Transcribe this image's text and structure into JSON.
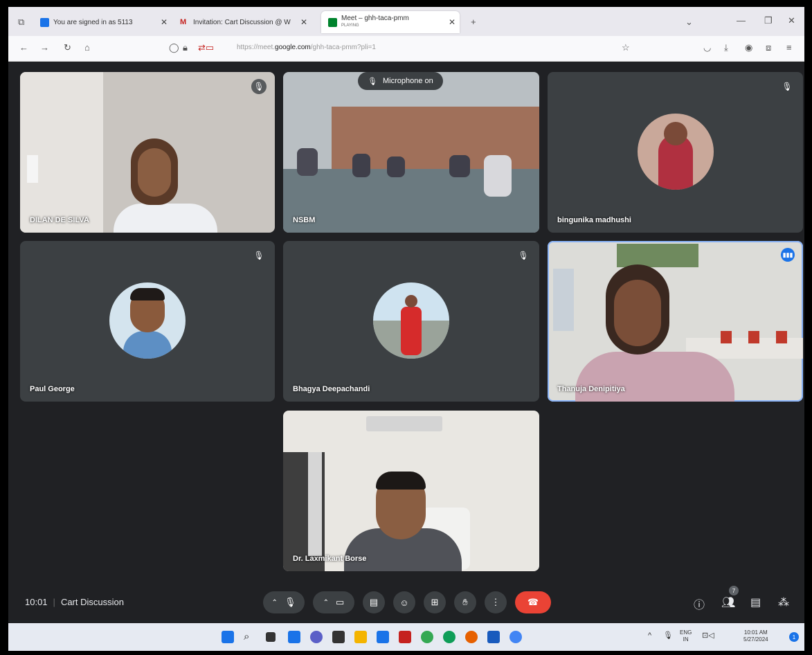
{
  "browser": {
    "tabs": [
      {
        "label": "You are signed in as 5113",
        "favicon_color": "#1a73e8"
      },
      {
        "label": "Invitation: Cart Discussion @ W",
        "favicon_color": "#c5221f"
      },
      {
        "label": "Meet – ghh-taca-pmm",
        "sublabel": "PLAYING",
        "favicon_color": "#00832d"
      }
    ],
    "new_tab": "+",
    "url_prefix": "https://meet.",
    "url_domain": "google.com",
    "url_suffix": "/ghh-taca-pmm?pli=1"
  },
  "meeting": {
    "time": "10:01",
    "title": "Cart Discussion",
    "mic_banner": "Microphone on",
    "participants_count": "7",
    "accent_color": "#8ab4f8",
    "end_call_color": "#ea4335",
    "tiles": [
      {
        "name": "DILAN DE SILVA",
        "muted": true,
        "type": "video"
      },
      {
        "name": "NSBM",
        "muted": false,
        "type": "video"
      },
      {
        "name": "bingunika madhushi",
        "muted": true,
        "type": "avatar"
      },
      {
        "name": "Paul George",
        "muted": true,
        "type": "avatar"
      },
      {
        "name": "Bhagya Deepachandi",
        "muted": true,
        "type": "avatar"
      },
      {
        "name": "Thanuja Denipitiya",
        "muted": false,
        "speaking": true,
        "type": "video"
      },
      {
        "name": "Dr. Laxmikant Borse",
        "muted": false,
        "type": "video"
      }
    ]
  },
  "taskbar": {
    "lang_top": "ENG",
    "lang_bottom": "IN",
    "clock_time": "10:01 AM",
    "clock_date": "5/27/2024",
    "notification_count": "1"
  }
}
